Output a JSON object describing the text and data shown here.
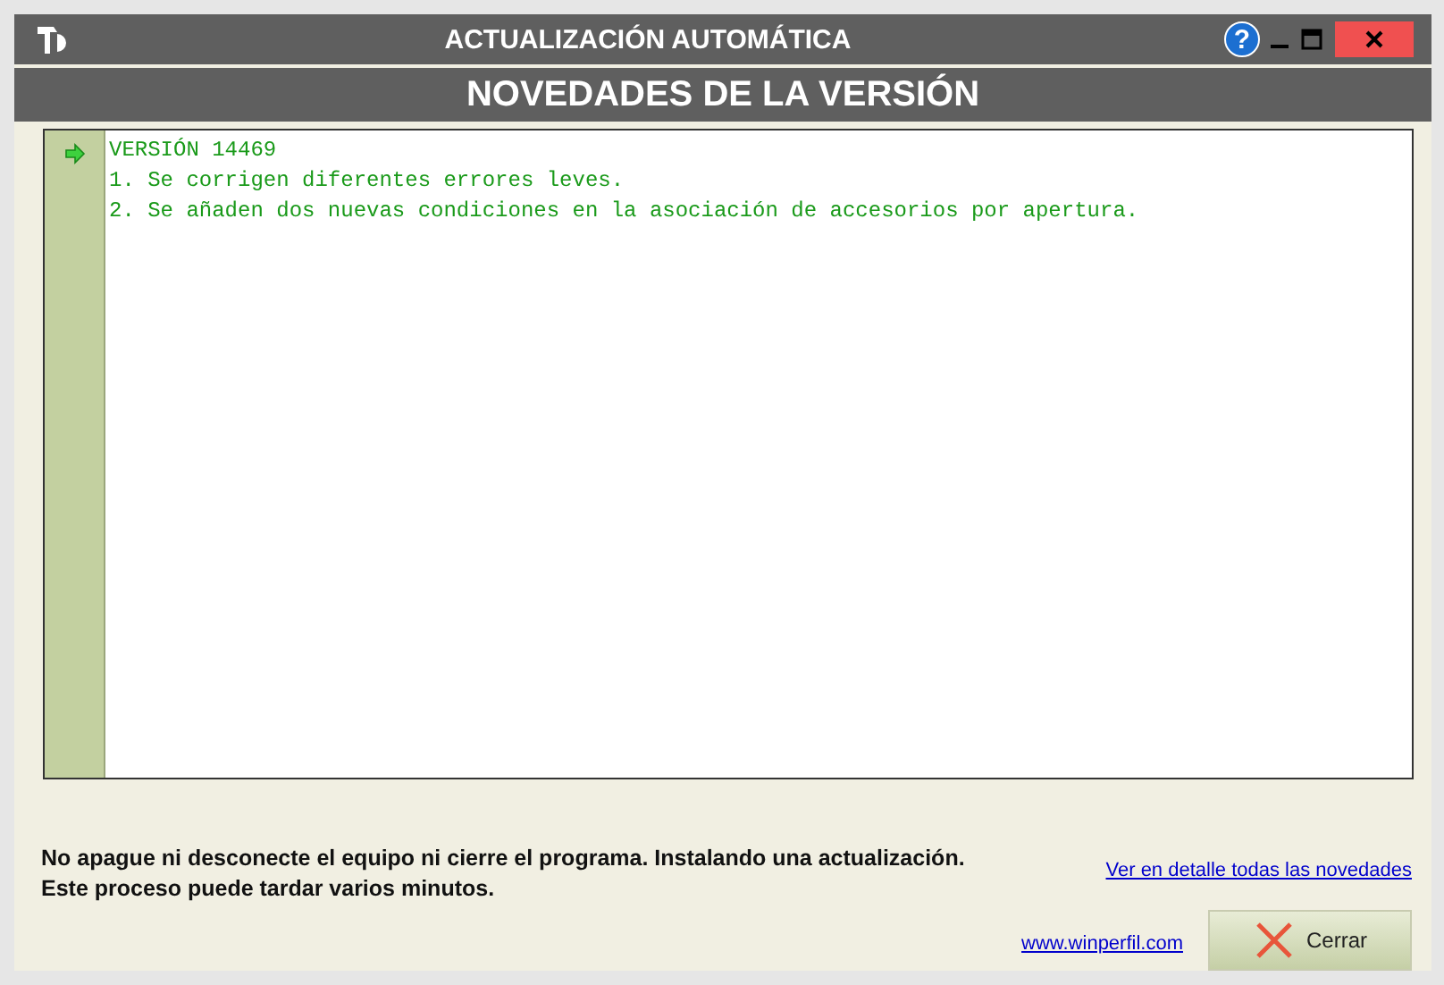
{
  "window": {
    "title": "ACTUALIZACIÓN AUTOMÁTICA",
    "buttons": [
      {
        "kind": "help",
        "label": "?"
      },
      {
        "kind": "minimize"
      },
      {
        "kind": "maximize"
      },
      {
        "kind": "close"
      }
    ]
  },
  "header": "NOVEDADES DE LA VERSIÓN",
  "notes": [
    {
      "text": "VERSIÓN 14469",
      "marked": true
    },
    {
      "text": "1. Se corrigen diferentes errores leves.",
      "marked": false
    },
    {
      "text": "2. Se añaden dos nuevas condiciones en la asociación de accesorios por apertura.",
      "marked": false
    }
  ],
  "message": [
    "No apague ni desconecte el equipo ni cierre el programa. Instalando una actualización.",
    "Este proceso puede tardar varios minutos."
  ],
  "details_link": "Ver en detalle todas las novedades",
  "website_link": "www.winperfil.com",
  "close_button": "Cerrar"
}
